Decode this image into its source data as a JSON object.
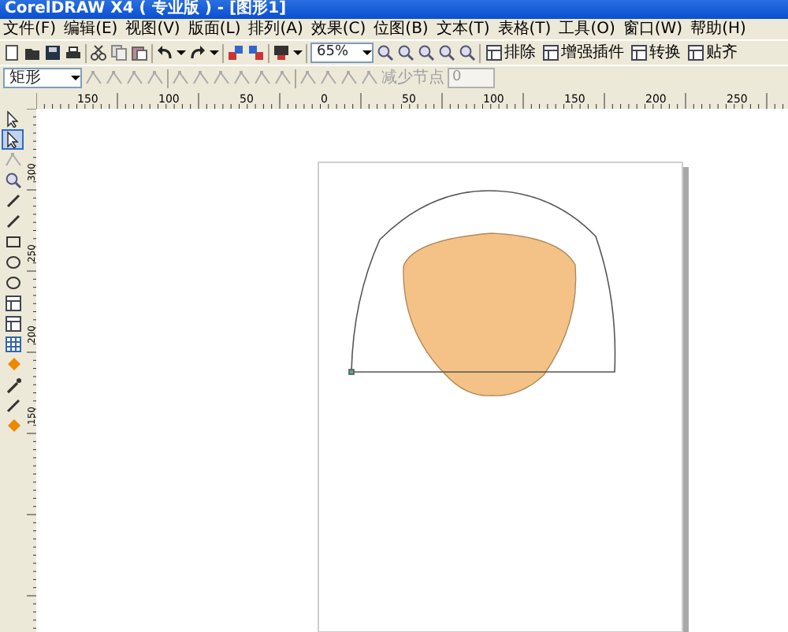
{
  "window": {
    "title": "CorelDRAW X4 ( 专业版 ) - [图形1]"
  },
  "menu": [
    "文件(F)",
    "编辑(E)",
    "视图(V)",
    "版面(L)",
    "排列(A)",
    "效果(C)",
    "位图(B)",
    "文本(T)",
    "表格(T)",
    "工具(O)",
    "窗口(W)",
    "帮助(H)"
  ],
  "standard_toolbar": {
    "zoom": "65%",
    "buttons": [
      {
        "label": "排除"
      },
      {
        "label": "增强插件"
      },
      {
        "label": "转换"
      },
      {
        "label": "贴齐"
      }
    ]
  },
  "property_bar": {
    "object_type": "矩形",
    "node_label": "减少节点",
    "node_value": "0"
  },
  "horizontal_ruler": [
    "150",
    "100",
    "50",
    "0",
    "50",
    "100",
    "150",
    "200",
    "250"
  ],
  "vertical_ruler": [
    "300",
    "250",
    "200",
    "150"
  ],
  "toolbox": [
    {
      "selected": false
    },
    {
      "selected": true
    },
    {
      "selected": false
    },
    {
      "selected": false
    },
    {
      "selected": false
    },
    {
      "selected": false
    },
    {
      "selected": false
    },
    {
      "selected": false
    },
    {
      "selected": false
    },
    {
      "selected": false
    },
    {
      "selected": false
    },
    {
      "selected": false
    },
    {
      "selected": false
    },
    {
      "selected": false
    },
    {
      "selected": false
    },
    {
      "selected": false
    }
  ]
}
